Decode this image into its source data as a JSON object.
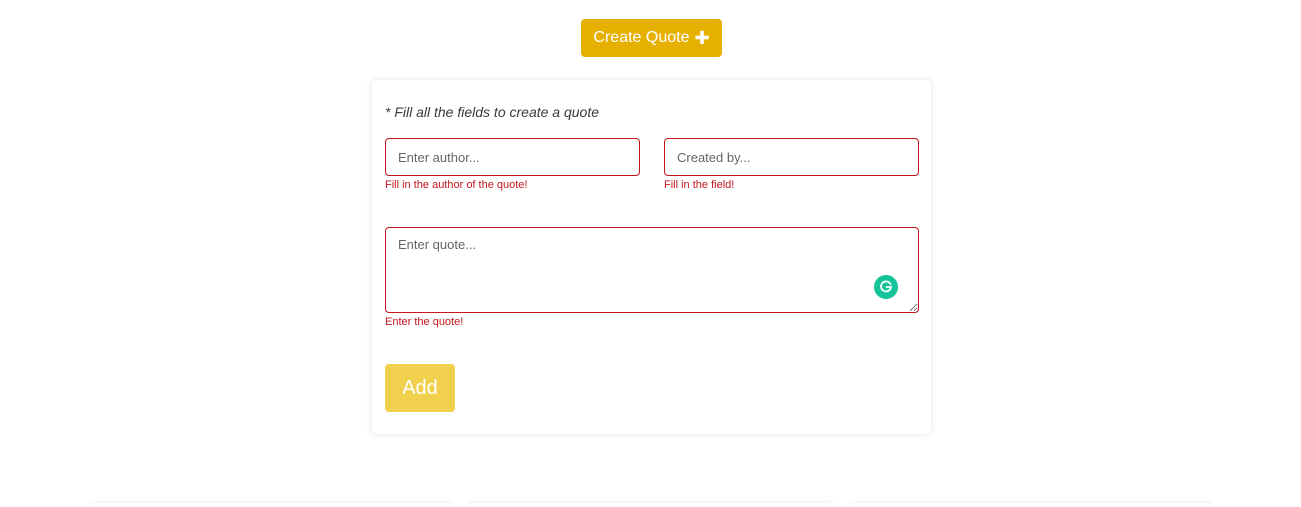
{
  "header": {
    "create_button_label": "Create Quote",
    "create_button_icon": "plus-icon"
  },
  "form": {
    "hint": "* Fill all the fields to create a quote",
    "author": {
      "value": "",
      "placeholder": "Enter author...",
      "error": "Fill in the author of the quote!"
    },
    "created_by": {
      "value": "",
      "placeholder": "Created by...",
      "error": "Fill in the field!"
    },
    "quote": {
      "value": "",
      "placeholder": "Enter quote...",
      "error": "Enter the quote!"
    },
    "add_button_label": "Add",
    "extension_icon": "grammarly-icon"
  },
  "colors": {
    "create_button": "#e6b000",
    "add_button": "#f0d04c",
    "error": "#c4161c",
    "grammarly": "#15c39a"
  }
}
